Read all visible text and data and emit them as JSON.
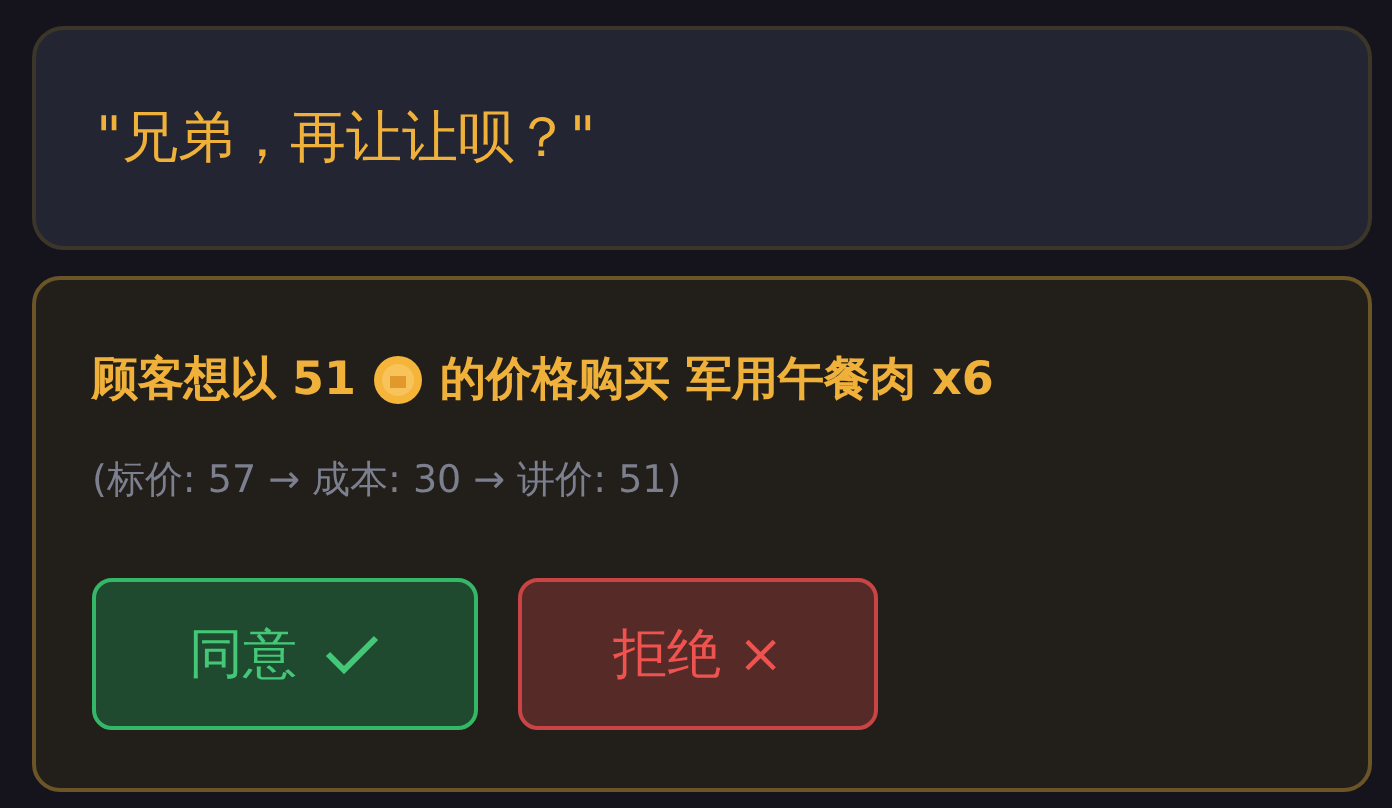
{
  "dialogue": {
    "quote": "\"兄弟，再让让呗？\""
  },
  "offer": {
    "prefix": "顾客想以 51",
    "suffix": "的价格购买 军用午餐肉 x6",
    "detail": "(标价: 57 → 成本: 30 → 讲价: 51)",
    "buttons": [
      {
        "kind": "accept",
        "label": "同意"
      },
      {
        "kind": "reject",
        "label": "拒绝 ×"
      }
    ]
  }
}
